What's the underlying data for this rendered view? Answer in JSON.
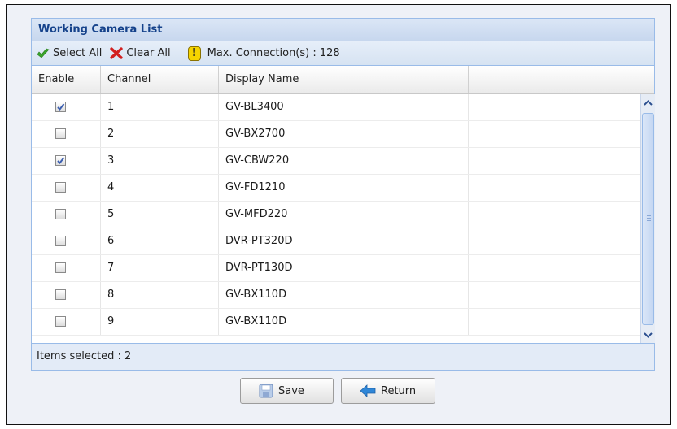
{
  "panel": {
    "title": "Working Camera List"
  },
  "toolbar": {
    "select_all": "Select All",
    "clear_all": "Clear All",
    "max_connections": "Max. Connection(s) : 128"
  },
  "columns": {
    "enable": "Enable",
    "channel": "Channel",
    "display_name": "Display Name"
  },
  "rows": [
    {
      "checked": true,
      "channel": "1",
      "name": "GV-BL3400"
    },
    {
      "checked": false,
      "channel": "2",
      "name": "GV-BX2700"
    },
    {
      "checked": true,
      "channel": "3",
      "name": "GV-CBW220"
    },
    {
      "checked": false,
      "channel": "4",
      "name": "GV-FD1210"
    },
    {
      "checked": false,
      "channel": "5",
      "name": "GV-MFD220"
    },
    {
      "checked": false,
      "channel": "6",
      "name": "DVR-PT320D"
    },
    {
      "checked": false,
      "channel": "7",
      "name": "DVR-PT130D"
    },
    {
      "checked": false,
      "channel": "8",
      "name": "GV-BX110D"
    },
    {
      "checked": false,
      "channel": "9",
      "name": "GV-BX110D"
    }
  ],
  "status": {
    "items_selected": "Items selected : 2"
  },
  "buttons": {
    "save": "Save",
    "return": "Return"
  },
  "colors": {
    "header_text": "#15428b",
    "panel_border": "#99bbe8",
    "check_mark": "#3c5fb0"
  },
  "icons": {
    "select_all": "green-check-icon",
    "clear_all": "red-x-icon",
    "warning": "warning-icon",
    "save": "floppy-disk-icon",
    "return": "blue-left-arrow-icon"
  }
}
